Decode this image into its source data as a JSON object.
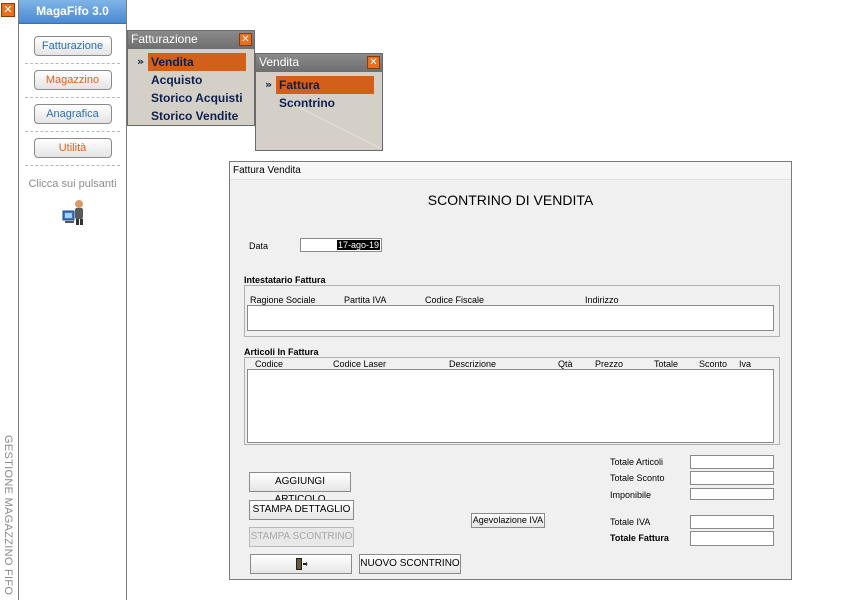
{
  "vertical_caption": "GESTIONE MAGAZZINO FIFO",
  "sidebar": {
    "title": "MagaFifo 3.0",
    "buttons": [
      {
        "label": "Fatturazione"
      },
      {
        "label": "Magazzino"
      },
      {
        "label": "Anagrafica"
      },
      {
        "label": "Utilità"
      }
    ],
    "hint": "Clicca sui pulsanti"
  },
  "menu_fatturazione": {
    "title": "Fatturazione",
    "items": [
      "Vendita",
      "Acquisto",
      "Storico Acquisti",
      "Storico Vendite"
    ],
    "selected": "Vendita"
  },
  "menu_vendita": {
    "title": "Vendita",
    "items": [
      "Fattura",
      "Scontrino"
    ],
    "selected": "Fattura"
  },
  "invoice_window": {
    "title": "Fattura Vendita",
    "heading": "SCONTRINO DI VENDITA",
    "date_label": "Data",
    "date_value": "17-ago-19",
    "intestatario": {
      "title": "Intestatario Fattura",
      "columns": [
        "Ragione Sociale",
        "Partita IVA",
        "Codice Fiscale",
        "Indirizzo"
      ]
    },
    "articoli": {
      "title": "Articoli In Fattura",
      "columns": [
        "Codice",
        "Codice Laser",
        "Descrizione",
        "Qtà",
        "Prezzo",
        "Totale",
        "Sconto",
        "Iva"
      ]
    },
    "buttons": {
      "aggiungi": "AGGIUNGI ARTICOLO",
      "stampa_dettaglio": "STAMPA DETTAGLIO",
      "stampa_scontrino": "STAMPA SCONTRINO",
      "agevolazione": "Agevolazione IVA",
      "nuovo": "NUOVO SCONTRINO"
    },
    "totals": {
      "totale_articoli": "Totale Articoli",
      "totale_sconto": "Totale Sconto",
      "imponibile": "Imponibile",
      "totale_iva": "Totale IVA",
      "totale_fattura": "Totale Fattura"
    }
  }
}
